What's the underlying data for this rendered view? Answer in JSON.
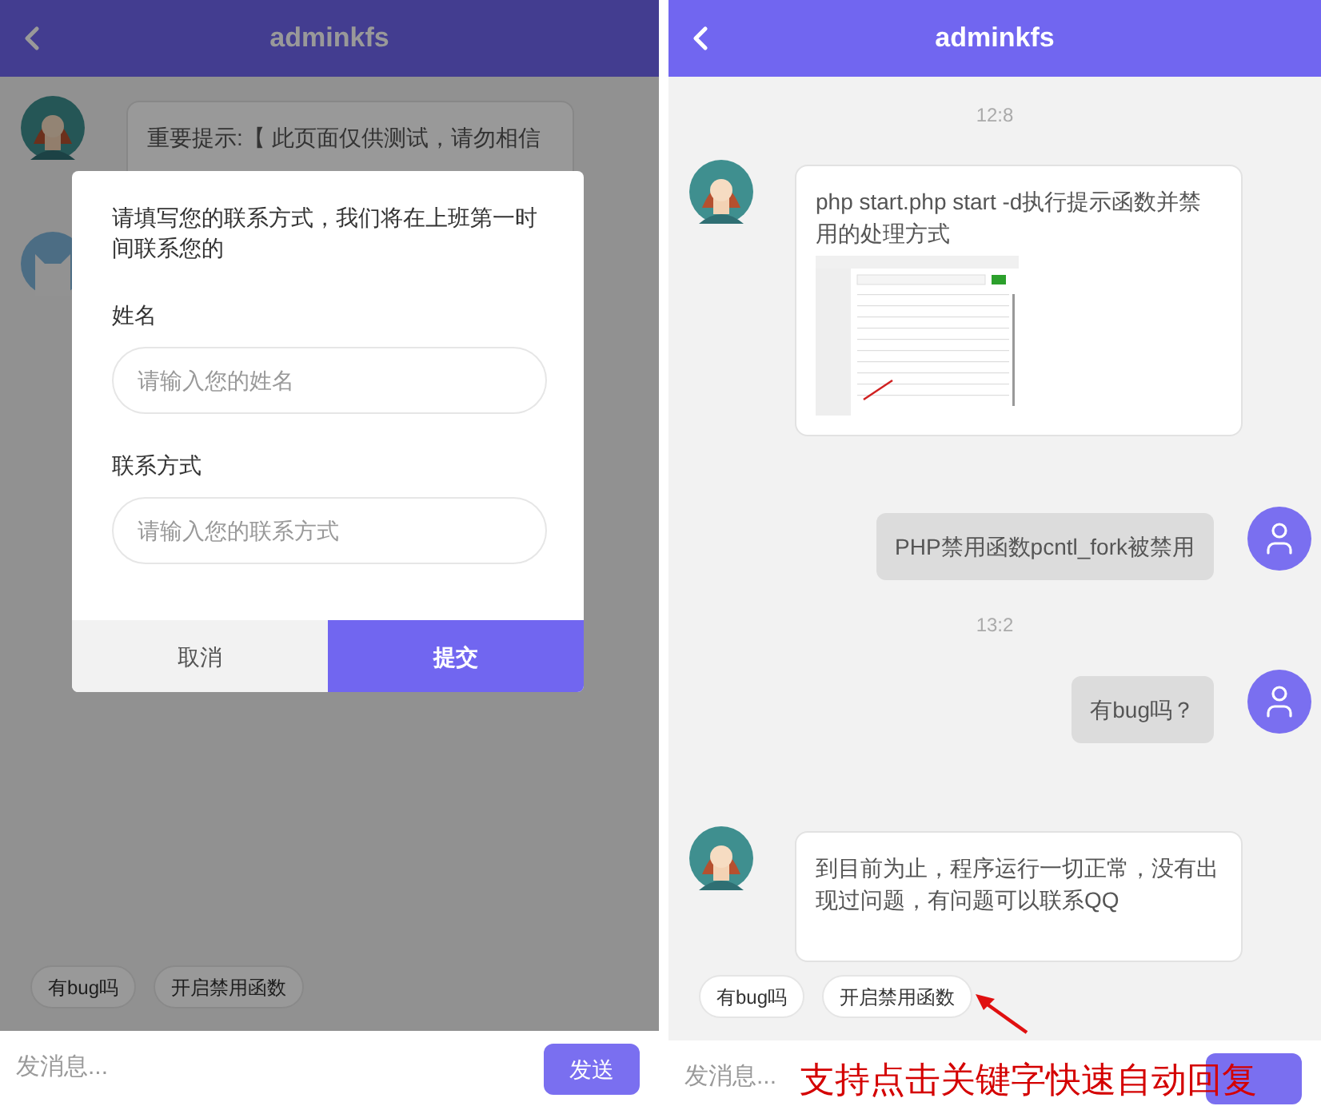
{
  "screens": [
    {
      "dimmed": true,
      "header": {
        "title": "adminkfs"
      },
      "messages": [
        {
          "kind": "incoming",
          "avatar": {
            "kind": "agent"
          },
          "text": "重要提示:【 此页面仅供测试，请勿相信"
        },
        {
          "kind": "incoming",
          "avatar": {
            "kind": "cat"
          }
        }
      ],
      "quick_replies": [
        "有bug吗",
        "开启禁用函数"
      ],
      "input": {
        "placeholder": "发消息...",
        "send": "发送"
      },
      "modal": {
        "prompt": "请填写您的联系方式，我们将在上班第一时间联系您的",
        "fields": [
          {
            "label": "姓名",
            "placeholder": "请输入您的姓名"
          },
          {
            "label": "联系方式",
            "placeholder": "请输入您的联系方式"
          }
        ],
        "buttons": [
          {
            "label": "取消",
            "primary": false
          },
          {
            "label": "提交",
            "primary": true
          }
        ]
      }
    },
    {
      "dimmed": false,
      "header": {
        "title": "adminkfs"
      },
      "messages": [
        {
          "kind": "time",
          "text": "12:8"
        },
        {
          "kind": "incoming",
          "avatar": {
            "kind": "agent"
          },
          "text": "php start.php start -d执行提示函数并禁用的处理方式",
          "screenshot": true
        },
        {
          "kind": "outgoing",
          "avatar": {
            "kind": "user"
          },
          "text": "PHP禁用函数pcntl_fork被禁用"
        },
        {
          "kind": "time",
          "text": "13:2"
        },
        {
          "kind": "outgoing",
          "avatar": {
            "kind": "user"
          },
          "text": "有bug吗？"
        },
        {
          "kind": "incoming",
          "avatar": {
            "kind": "agent"
          },
          "text": "到目前为止，程序运行一切正常，没有出现过问题，有问题可以联系QQ",
          "tall": true
        }
      ],
      "quick_replies": [
        "有bug吗",
        "开启禁用函数"
      ],
      "input": {
        "placeholder": "发消息..."
      }
    }
  ],
  "annotation": {
    "text": "支持点击关键字快速自动回复"
  }
}
